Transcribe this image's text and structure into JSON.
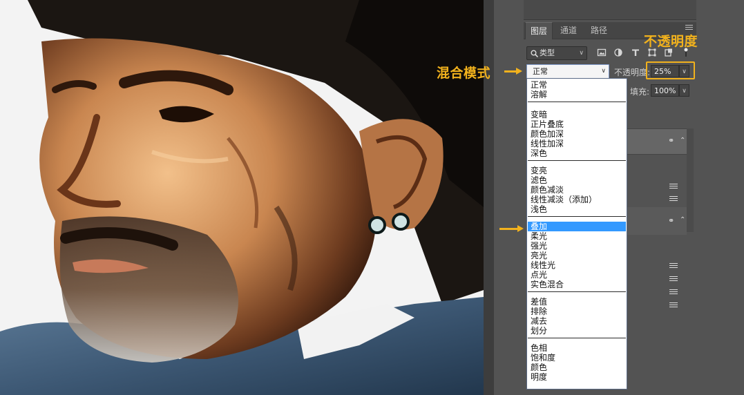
{
  "panel": {
    "tabs": [
      "图层",
      "通道",
      "路径"
    ],
    "filter_kind": "类型",
    "blend_mode": "正常",
    "opacity_label": "不透明度:",
    "opacity_value": "25%",
    "fill_label": "填充:",
    "fill_value": "100%"
  },
  "blend_menu": {
    "groups": [
      [
        "正常",
        "溶解"
      ],
      [
        "变暗",
        "正片叠底",
        "颜色加深",
        "线性加深",
        "深色"
      ],
      [
        "变亮",
        "滤色",
        "颜色减淡",
        "线性减淡（添加）",
        "浅色"
      ],
      [
        "叠加",
        "柔光",
        "强光",
        "亮光",
        "线性光",
        "点光",
        "实色混合"
      ],
      [
        "差值",
        "排除",
        "减去",
        "划分"
      ],
      [
        "色相",
        "饱和度",
        "颜色",
        "明度"
      ]
    ],
    "selected": "叠加"
  },
  "annotations": {
    "blend_mode": "混合模式",
    "opacity": "不透明度"
  },
  "colors": {
    "annotation": "#f2b21d",
    "panel_bg": "#535353",
    "selection": "#3399ff"
  },
  "icons": [
    "search-icon",
    "image-filter-icon",
    "adjustment-filter-icon",
    "text-filter-icon",
    "shape-filter-icon",
    "smart-object-filter-icon",
    "panel-menu-icon",
    "link-icon",
    "fx-icon"
  ]
}
